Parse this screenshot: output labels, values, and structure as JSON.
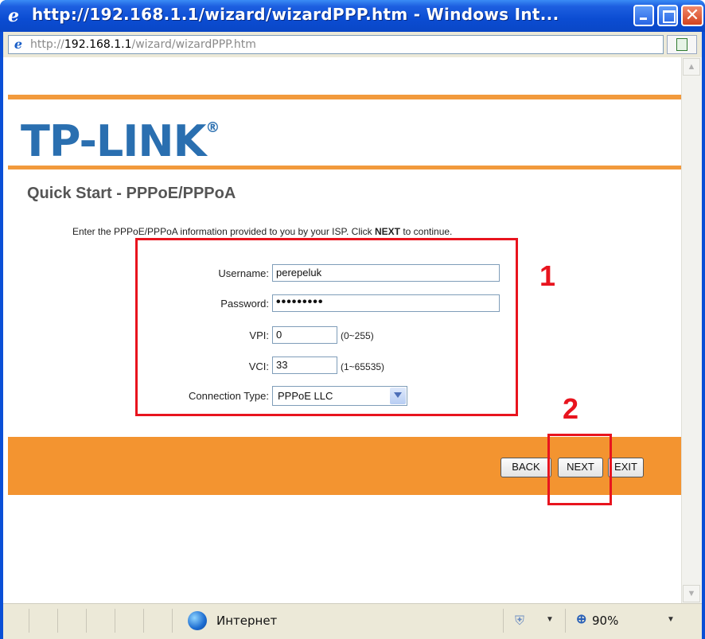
{
  "window": {
    "title": "http://192.168.1.1/wizard/wizardPPP.htm - Windows Int...",
    "address": {
      "prefix": "http://",
      "host": "192.168.1.1",
      "path": "/wizard/wizardPPP.htm"
    }
  },
  "page": {
    "logo": "TP-LINK",
    "logo_mark": "®",
    "title": "Quick Start - PPPoE/PPPoA",
    "instruction": "Enter the PPPoE/PPPoA information provided to you by your ISP. Click NEXT to continue.",
    "instruction_before": "Enter the PPPoE/PPPoA information provided to you by your ISP. Click ",
    "instruction_bold": "NEXT",
    "instruction_after": " to continue."
  },
  "form": {
    "username_label": "Username:",
    "username_value": "perepeluk",
    "password_label": "Password:",
    "password_value": "•••••••••",
    "vpi_label": "VPI:",
    "vpi_value": "0",
    "vpi_hint": "(0~255)",
    "vci_label": "VCI:",
    "vci_value": "33",
    "vci_hint": "(1~65535)",
    "conn_type_label": "Connection Type:",
    "conn_type_value": "PPPoE LLC"
  },
  "buttons": {
    "back": "BACK",
    "next": "NEXT",
    "exit": "EXIT"
  },
  "annotations": {
    "step1": "1",
    "step2": "2",
    "color": "#e8141e"
  },
  "statusbar": {
    "zone": "Интернет",
    "zoom": "90%"
  },
  "colors": {
    "accent_orange": "#f39430",
    "logo_blue": "#2a6fb0",
    "titlebar_blue": "#0a4fd6"
  }
}
